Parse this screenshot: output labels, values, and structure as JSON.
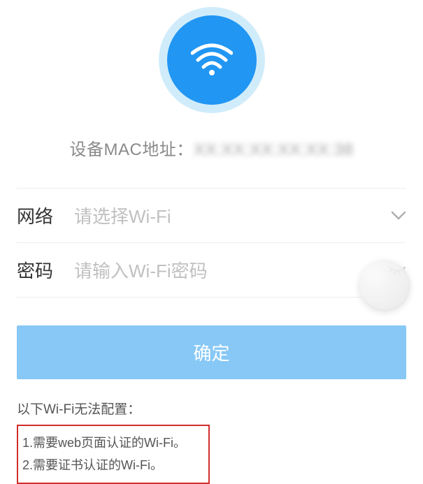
{
  "header": {
    "mac_label": "设备MAC地址：",
    "mac_value": "XX:XX:XX:XX:XX:38"
  },
  "form": {
    "network": {
      "label": "网络",
      "placeholder": "请选择Wi-Fi"
    },
    "password": {
      "label": "密码",
      "placeholder": "请输入Wi-Fi密码"
    }
  },
  "button": {
    "confirm": "确定"
  },
  "note": {
    "title": "以下Wi-Fi无法配置：",
    "items": [
      "1.需要web页面认证的Wi-Fi。",
      "2.需要证书认证的Wi-Fi。"
    ]
  },
  "icons": {
    "wifi": "wifi-icon",
    "chevron": "chevron-down-icon",
    "eye": "eye-hidden-icon"
  },
  "colors": {
    "accent": "#2196f3",
    "button": "#87c8f6",
    "warning_border": "#d22c2c"
  }
}
